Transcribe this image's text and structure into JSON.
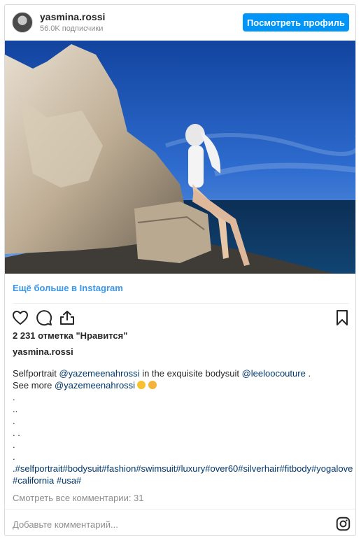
{
  "header": {
    "username": "yasmina.rossi",
    "followers": "56.0K подписчики",
    "profile_button": "Посмотреть профиль"
  },
  "post": {
    "more_link": "Ещё больше в Instagram",
    "likes": "2 231 отметка \"Нравится\"",
    "author": "yasmina.rossi",
    "caption": {
      "line1_pre": "Selfportrait ",
      "mention1": "@yazemeenahrossi",
      "line1_mid": " in the exquisite bodysuit ",
      "mention2": "@leeloocouture",
      "line1_post": " .",
      "line2_pre": "See more ",
      "mention3": "@yazemeenahrossi",
      "dots": [
        ".",
        "..",
        ".",
        ". .",
        ".",
        "."
      ],
      "hashtags_line1": ".#selfportrait#bodysuit#fashion#swimsuit#luxury#over60#silverhair#fitbody#yogalove",
      "hashtags_line2": "#california #usa#"
    },
    "view_comments": "Смотреть все комментарии: 31",
    "comment_placeholder": "Добавьте комментарий..."
  },
  "icons": [
    "heart-icon",
    "comment-icon",
    "share-icon",
    "bookmark-icon",
    "instagram-icon"
  ],
  "colors": {
    "accent": "#0095f6",
    "link": "#3897f0",
    "mention": "#00376b",
    "muted": "#8e8e8e"
  }
}
